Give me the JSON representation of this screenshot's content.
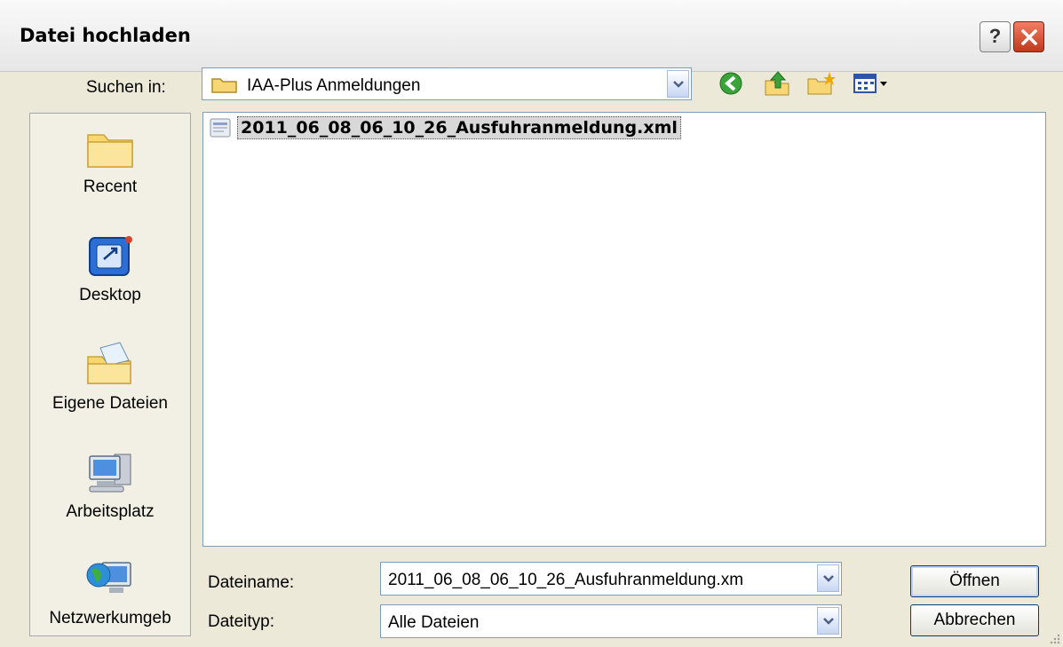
{
  "window": {
    "title": "Datei hochladen",
    "help_label": "?"
  },
  "lookin": {
    "label": "Suchen in:",
    "value": "IAA-Plus Anmeldungen"
  },
  "places": [
    {
      "label": "Recent",
      "icon": "recent-folder-icon"
    },
    {
      "label": "Desktop",
      "icon": "desktop-icon"
    },
    {
      "label": "Eigene Dateien",
      "icon": "my-documents-icon"
    },
    {
      "label": "Arbeitsplatz",
      "icon": "my-computer-icon"
    },
    {
      "label": "Netzwerkumgeb",
      "icon": "network-icon"
    }
  ],
  "files": [
    {
      "name": "2011_06_08_06_10_26_Ausfuhranmeldung.xml",
      "icon": "xml-file-icon",
      "selected": true
    }
  ],
  "filename": {
    "label": "Dateiname:",
    "value": "2011_06_08_06_10_26_Ausfuhranmeldung.xm"
  },
  "filetype": {
    "label": "Dateityp:",
    "value": "Alle Dateien"
  },
  "buttons": {
    "open": "Öffnen",
    "cancel": "Abbrechen"
  },
  "colors": {
    "title_bar": "#f0f0f0",
    "dialog_bg": "#ece9d8",
    "close_red": "#d9502d",
    "selection": "#d8d8d8"
  }
}
